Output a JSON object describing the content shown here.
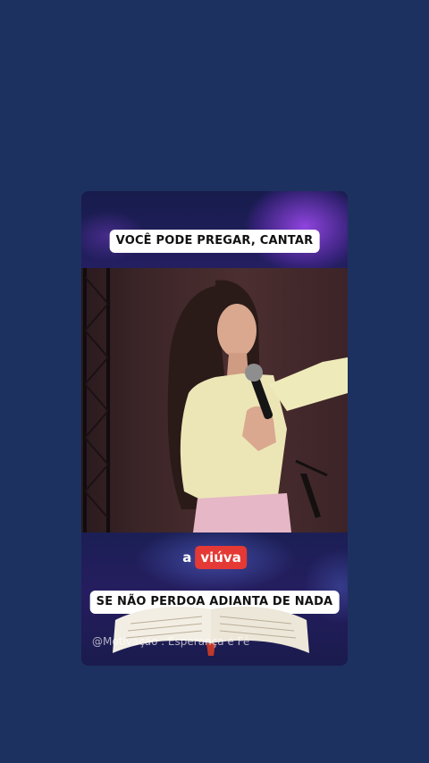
{
  "caption_top": "VOCÊ PODE PREGAR, CANTAR",
  "name_tag": {
    "article": "a",
    "word": "viúva"
  },
  "caption_bottom": "SE NÃO PERDOA ADIANTA DE NADA",
  "watermark": "@Motivação . Esperança e Fé",
  "colors": {
    "background": "#1d3160",
    "caption_bg": "#ffffff",
    "name_highlight": "#e53935",
    "accent_purple": "#8a3fe0"
  }
}
